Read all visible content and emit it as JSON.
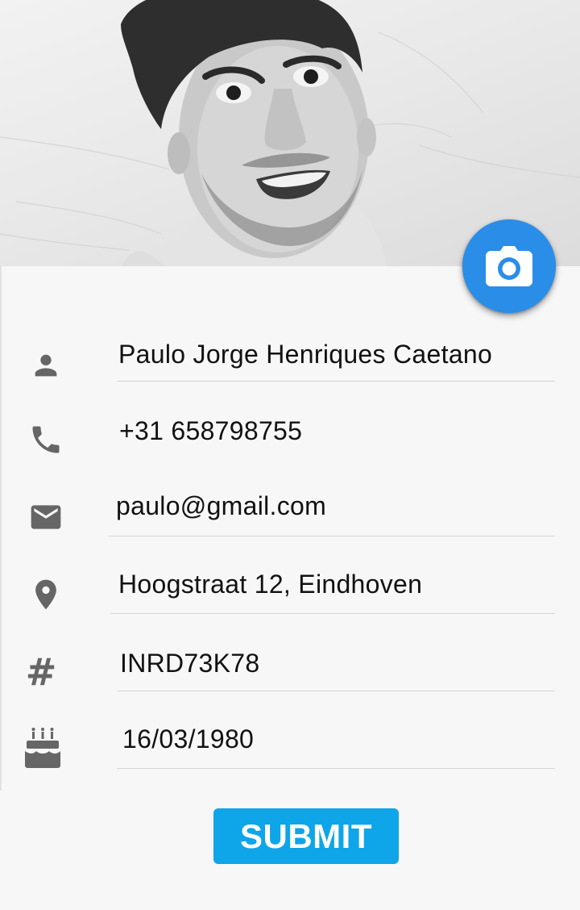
{
  "profile": {
    "photo": {
      "description_icon": "profile-photo",
      "colors": {
        "background": "#e9e9e9"
      }
    },
    "camera_button": {
      "icon": "camera-icon",
      "color": "#2a8de8"
    }
  },
  "form": {
    "fields": [
      {
        "id": "name",
        "icon": "person-icon",
        "value": "Paulo Jorge Henriques Caetano"
      },
      {
        "id": "phone",
        "icon": "phone-icon",
        "value": "+31 658798755"
      },
      {
        "id": "email",
        "icon": "email-icon",
        "value": "paulo@gmail.com"
      },
      {
        "id": "address",
        "icon": "location-pin-icon",
        "value": "Hoogstraat 12, Eindhoven"
      },
      {
        "id": "code",
        "icon": "hash-icon",
        "glyph": "#",
        "value": "INRD73K78"
      },
      {
        "id": "birthdate",
        "icon": "birthday-cake-icon",
        "value": "16/03/1980"
      }
    ],
    "submit_label": "SUBMIT",
    "submit_color": "#0ea5e9"
  }
}
